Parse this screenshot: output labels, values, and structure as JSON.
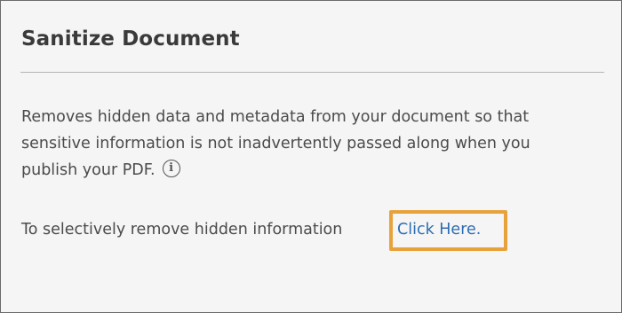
{
  "panel": {
    "title": "Sanitize Document",
    "description": "Removes hidden data and metadata from your document so that sensitive information is not inadvertently passed along when you publish your PDF.",
    "info_icon": "info-circle-icon",
    "selective_text": "To selectively remove hidden information",
    "link_text": "Click Here."
  },
  "colors": {
    "highlight": "#e8a23c",
    "link": "#2d6db3",
    "background": "#f5f5f5"
  }
}
